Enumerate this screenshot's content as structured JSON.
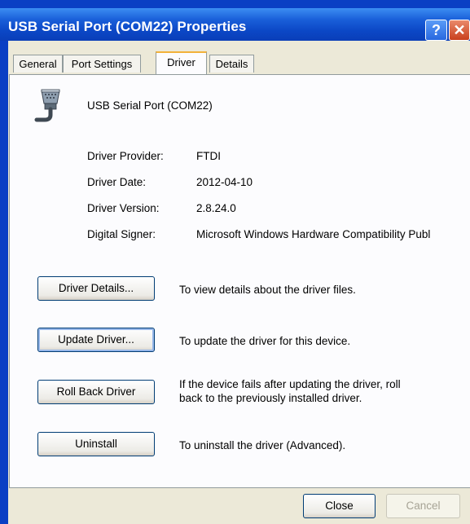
{
  "window": {
    "title": "USB Serial Port (COM22) Properties",
    "help_glyph": "?",
    "close_glyph": "✕"
  },
  "tabs": [
    {
      "label": "General"
    },
    {
      "label": "Port Settings"
    },
    {
      "label": "Driver",
      "active": true
    },
    {
      "label": "Details"
    }
  ],
  "device": {
    "icon": "serial-port-connector-icon",
    "name": "USB Serial Port (COM22)"
  },
  "driver_info": [
    {
      "label": "Driver Provider:",
      "value": "FTDI"
    },
    {
      "label": "Driver Date:",
      "value": "2012-04-10"
    },
    {
      "label": "Driver Version:",
      "value": "2.8.24.0"
    },
    {
      "label": "Digital Signer:",
      "value": "Microsoft Windows Hardware Compatibility Publ"
    }
  ],
  "actions": [
    {
      "button": "Driver Details...",
      "desc": "To view details about the driver files."
    },
    {
      "button": "Update Driver...",
      "desc": "To update the driver for this device."
    },
    {
      "button": "Roll Back Driver",
      "desc_line1": "If the device fails after updating the driver, roll",
      "desc_line2": "back to the previously installed driver."
    },
    {
      "button": "Uninstall",
      "desc": "To uninstall the driver (Advanced)."
    }
  ],
  "footer": {
    "close_label": "Close",
    "cancel_label": "Cancel"
  },
  "colors": {
    "titlebar": "#0b47c6",
    "dialog_face": "#ece9d8",
    "tab_highlight": "#f2b23a"
  }
}
